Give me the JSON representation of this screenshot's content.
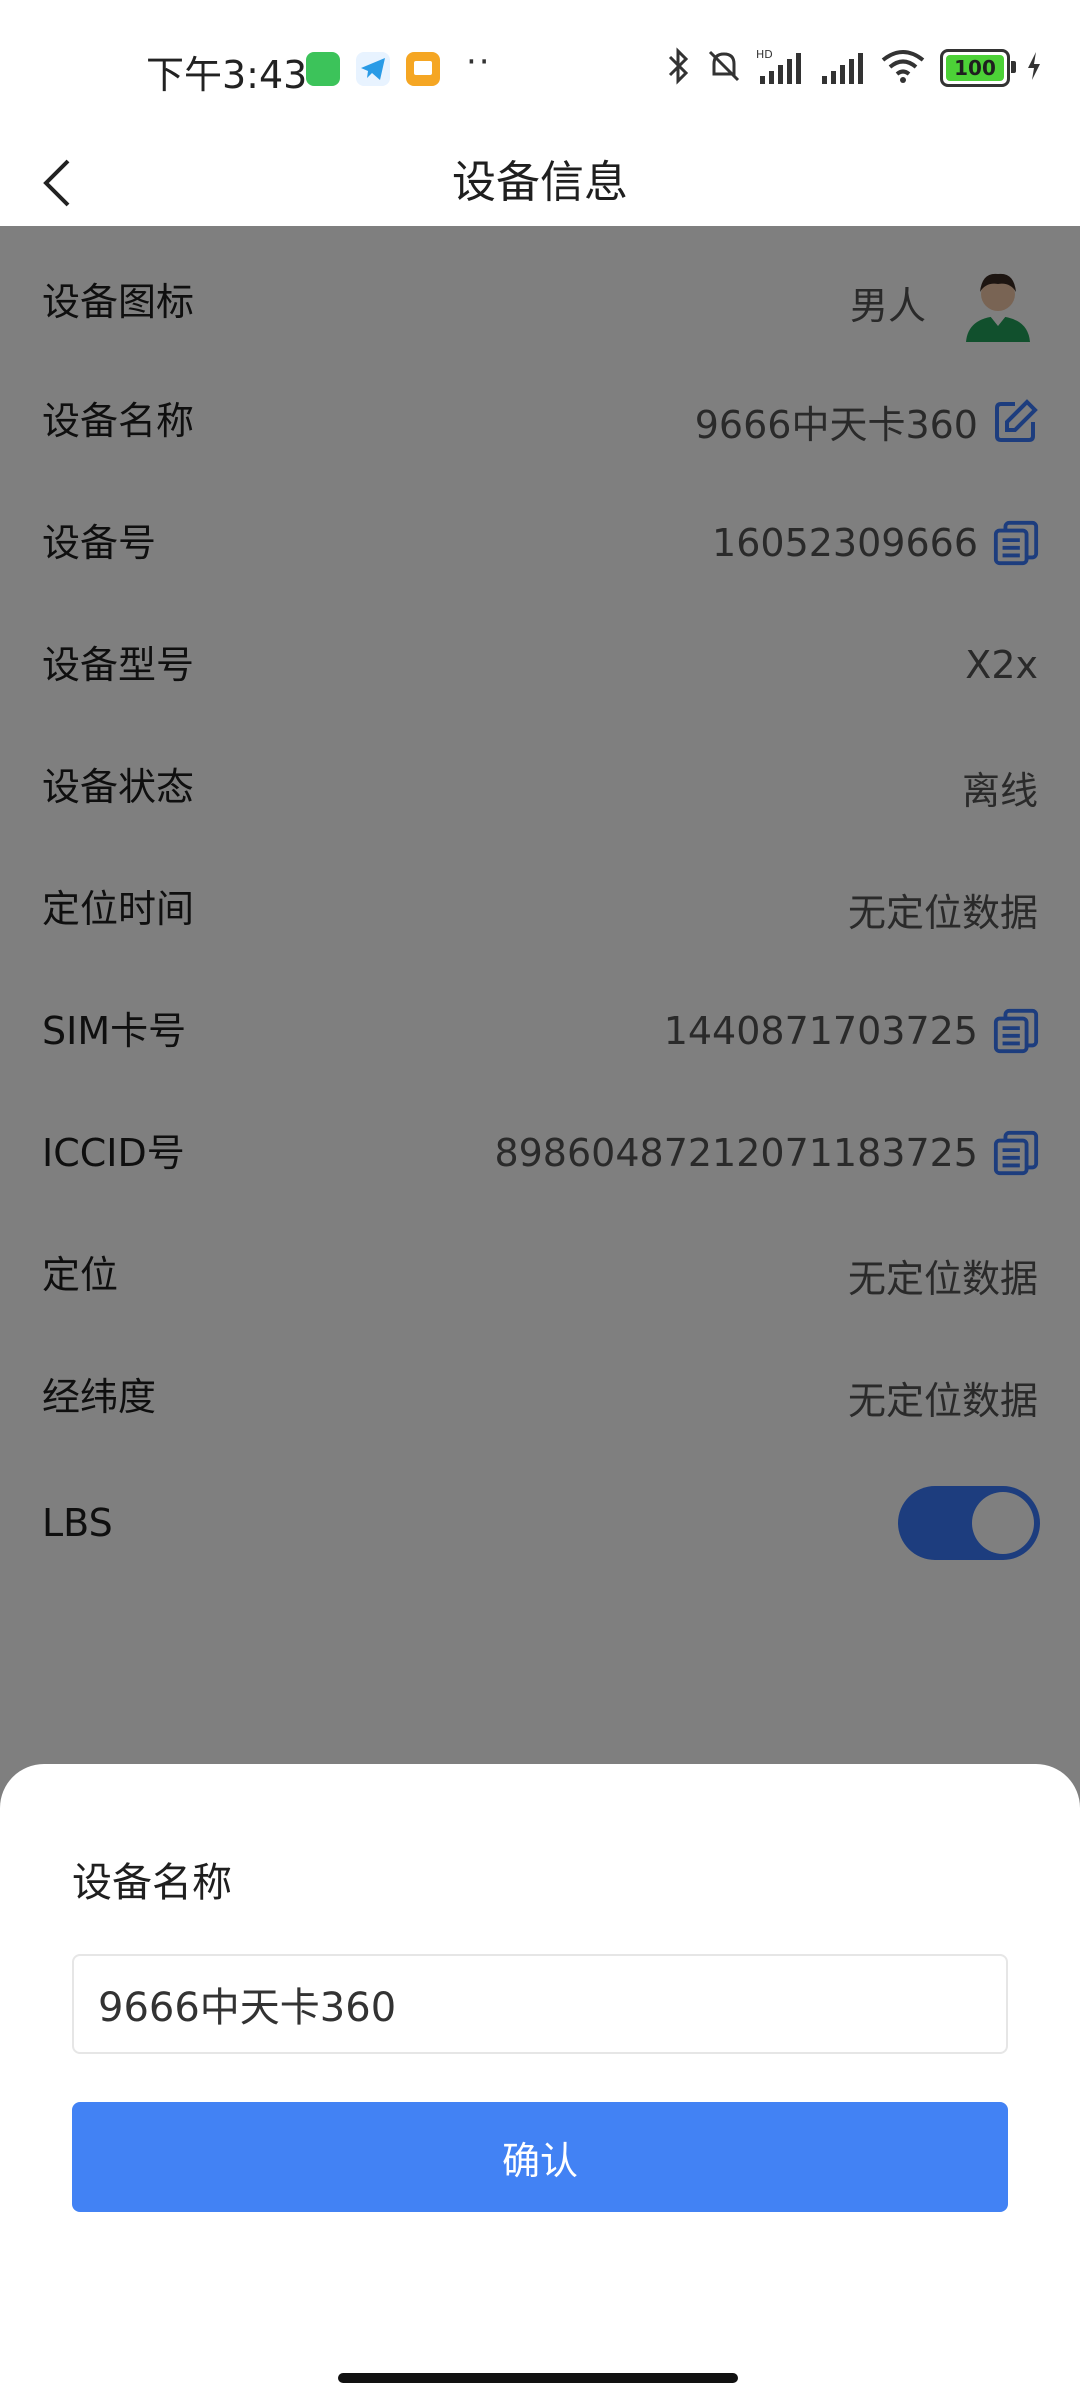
{
  "status_bar": {
    "time": "下午3:43",
    "dots": "··",
    "battery": "100"
  },
  "header": {
    "title": "设备信息"
  },
  "rows": [
    {
      "label": "设备图标",
      "value": "男人"
    },
    {
      "label": "设备名称",
      "value": "9666中天卡360"
    },
    {
      "label": "设备号",
      "value": "16052309666"
    },
    {
      "label": "设备型号",
      "value": "X2x"
    },
    {
      "label": "设备状态",
      "value": "离线"
    },
    {
      "label": "定位时间",
      "value": "无定位数据"
    },
    {
      "label": "SIM卡号",
      "value": "1440871703725"
    },
    {
      "label": "ICCID号",
      "value": "89860487212071183725"
    },
    {
      "label": "定位",
      "value": "无定位数据"
    },
    {
      "label": "经纬度",
      "value": "无定位数据"
    },
    {
      "label": "LBS",
      "toggle_on": true
    }
  ],
  "sheet": {
    "title": "设备名称",
    "input_value": "9666中天卡360",
    "confirm_label": "确认"
  },
  "colors": {
    "accent": "#3a7bfd",
    "confirm_button": "#4282f4",
    "overlay": "rgba(0,0,0,0.5)"
  }
}
